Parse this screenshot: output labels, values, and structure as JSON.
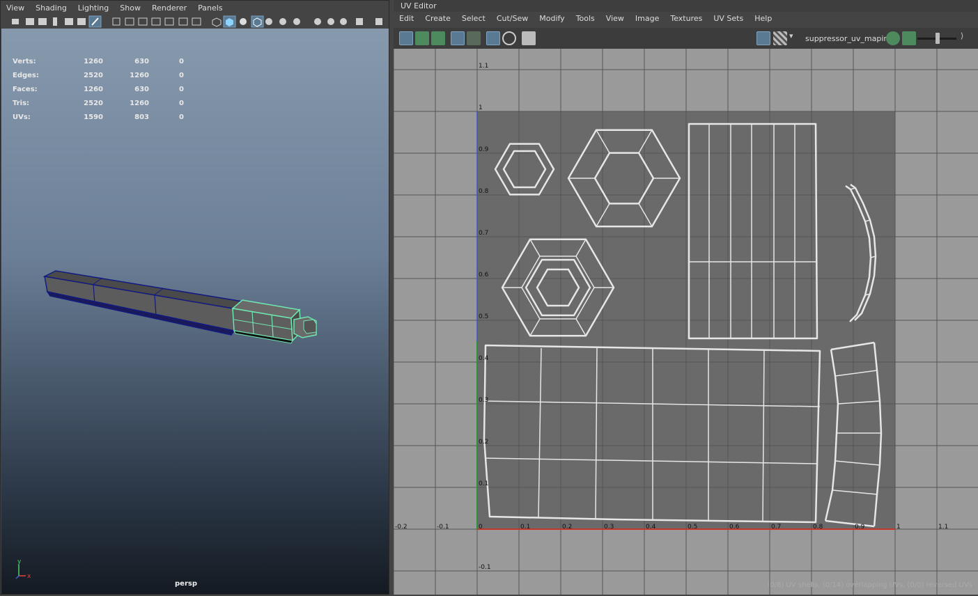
{
  "viewport": {
    "menu": [
      "View",
      "Shading",
      "Lighting",
      "Show",
      "Renderer",
      "Panels"
    ],
    "hud": [
      {
        "label": "Verts:",
        "c1": "1260",
        "c2": "630",
        "c3": "0"
      },
      {
        "label": "Edges:",
        "c1": "2520",
        "c2": "1260",
        "c3": "0"
      },
      {
        "label": "Faces:",
        "c1": "1260",
        "c2": "630",
        "c3": "0"
      },
      {
        "label": "Tris:",
        "c1": "2520",
        "c2": "1260",
        "c3": "0"
      },
      {
        "label": "UVs:",
        "c1": "1590",
        "c2": "803",
        "c3": "0"
      }
    ],
    "camera": "persp",
    "axis_x": "x",
    "axis_y": "y"
  },
  "uv_editor": {
    "title": "UV Editor",
    "menu": [
      "Edit",
      "Create",
      "Select",
      "Cut/Sew",
      "Modify",
      "Tools",
      "View",
      "Image",
      "Textures",
      "UV Sets",
      "Help"
    ],
    "map_name": "suppressor_uv_mapin",
    "x_ticks": [
      "-0.2",
      "-0.1",
      "0",
      "0.1",
      "0.2",
      "0.3",
      "0.4",
      "0.5",
      "0.6",
      "0.7",
      "0.8",
      "0.9",
      "1",
      "1.1"
    ],
    "y_ticks": [
      "1.1",
      "1",
      "0.9",
      "0.8",
      "0.7",
      "0.6",
      "0.5",
      "0.4",
      "0.3",
      "0.2",
      "0.1",
      "-0.1"
    ],
    "status": "(0/8) UV shells, (0/14) overlapping UVs, (0/0) reversed UVs",
    "colors": {
      "grid_bg": "#9a9a9a",
      "uv_space": "#6a6a6a",
      "grid_line": "#555555",
      "wire": "#e6e6e6",
      "u_axis": "#c0392b",
      "v_axis": "#2f8f3a",
      "v_axis_top": "#3a56c6"
    }
  }
}
